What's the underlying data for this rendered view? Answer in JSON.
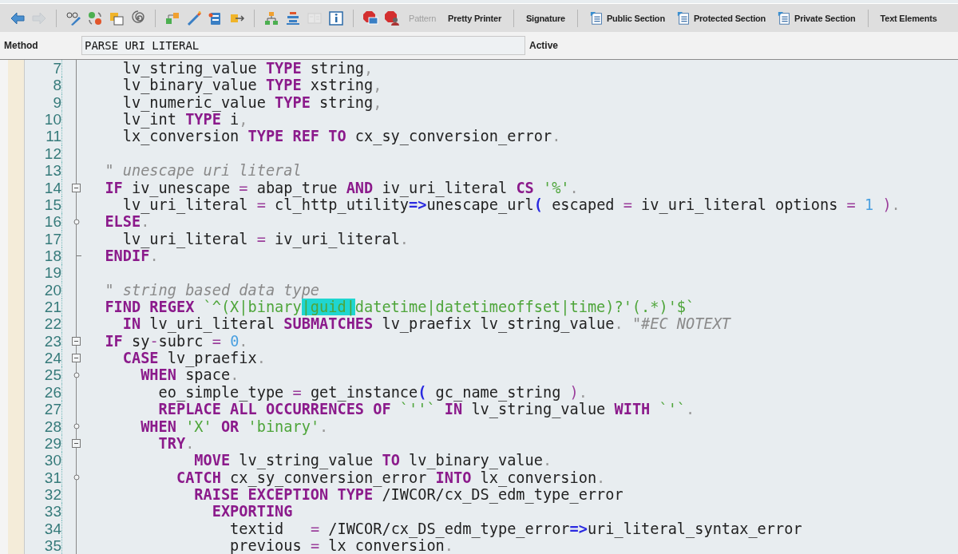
{
  "toolbar": [
    {
      "kind": "icon",
      "disabled": false
    },
    {
      "kind": "icon",
      "disabled": true
    },
    {
      "kind": "separator"
    },
    {
      "kind": "icon",
      "disabled": false
    },
    {
      "kind": "icon",
      "disabled": false
    },
    {
      "kind": "icon",
      "disabled": false
    },
    {
      "kind": "icon",
      "disabled": false
    },
    {
      "kind": "separator"
    },
    {
      "kind": "icon",
      "disabled": false
    },
    {
      "kind": "icon",
      "disabled": false
    },
    {
      "kind": "icon",
      "disabled": false
    },
    {
      "kind": "icon",
      "disabled": false
    },
    {
      "kind": "separator"
    },
    {
      "kind": "icon",
      "disabled": false
    },
    {
      "kind": "icon",
      "disabled": false
    },
    {
      "kind": "icon",
      "disabled": true
    },
    {
      "kind": "icon",
      "disabled": false
    },
    {
      "kind": "separator"
    },
    {
      "kind": "icon",
      "disabled": false
    },
    {
      "kind": "icon",
      "disabled": false
    },
    {
      "kind": "button",
      "label": "Pattern",
      "with_icon": false,
      "disabled": true
    },
    {
      "kind": "button",
      "label": "Pretty Printer",
      "with_icon": false,
      "disabled": false
    },
    {
      "kind": "separator"
    },
    {
      "kind": "button",
      "label": "Signature",
      "with_icon": false,
      "disabled": false
    },
    {
      "kind": "separator"
    },
    {
      "kind": "button",
      "label": "Public Section",
      "with_icon": true,
      "disabled": false
    },
    {
      "kind": "button",
      "label": "Protected Section",
      "with_icon": true,
      "disabled": false
    },
    {
      "kind": "button",
      "label": "Private Section",
      "with_icon": true,
      "disabled": false
    },
    {
      "kind": "separator"
    },
    {
      "kind": "button",
      "label": "Text Elements",
      "with_icon": false,
      "disabled": false
    }
  ],
  "header": {
    "label": "Method",
    "value": "PARSE_URI_LITERAL",
    "status": "Active"
  },
  "lines": [
    {
      "number": "7",
      "code": [
        {
          "kind": "plain",
          "text": "    lv_string_value "
        },
        {
          "kind": "keyword",
          "text": "TYPE"
        },
        {
          "kind": "plain",
          "text": " string"
        },
        {
          "kind": "punct",
          "text": ","
        }
      ]
    },
    {
      "number": "8",
      "code": [
        {
          "kind": "plain",
          "text": "    lv_binary_value "
        },
        {
          "kind": "keyword",
          "text": "TYPE"
        },
        {
          "kind": "plain",
          "text": " xstring"
        },
        {
          "kind": "punct",
          "text": ","
        }
      ]
    },
    {
      "number": "9",
      "code": [
        {
          "kind": "plain",
          "text": "    lv_numeric_value "
        },
        {
          "kind": "keyword",
          "text": "TYPE"
        },
        {
          "kind": "plain",
          "text": " string"
        },
        {
          "kind": "punct",
          "text": ","
        }
      ]
    },
    {
      "number": "10",
      "code": [
        {
          "kind": "plain",
          "text": "    lv_int "
        },
        {
          "kind": "keyword",
          "text": "TYPE"
        },
        {
          "kind": "plain",
          "text": " i"
        },
        {
          "kind": "punct",
          "text": ","
        }
      ]
    },
    {
      "number": "11",
      "code": [
        {
          "kind": "plain",
          "text": "    lx_conversion "
        },
        {
          "kind": "keyword",
          "text": "TYPE REF TO"
        },
        {
          "kind": "plain",
          "text": " cx_sy_conversion_error"
        },
        {
          "kind": "punct",
          "text": "."
        }
      ]
    },
    {
      "number": "12"
    },
    {
      "number": "13",
      "code": [
        {
          "kind": "comment",
          "text": "  \" unescape uri literal"
        }
      ]
    },
    {
      "number": "14",
      "fold": {
        "kind": "toggle",
        "expanded": true
      },
      "code": [
        {
          "kind": "keyword",
          "text": "  IF"
        },
        {
          "kind": "plain",
          "text": " iv_unescape "
        },
        {
          "kind": "operator",
          "text": "="
        },
        {
          "kind": "plain",
          "text": " abap_true "
        },
        {
          "kind": "keyword",
          "text": "AND"
        },
        {
          "kind": "plain",
          "text": " iv_uri_literal "
        },
        {
          "kind": "keyword",
          "text": "CS "
        },
        {
          "kind": "string",
          "text": "'%'"
        },
        {
          "kind": "punct",
          "text": "."
        }
      ]
    },
    {
      "number": "15",
      "code": [
        {
          "kind": "plain",
          "text": "    lv_uri_literal "
        },
        {
          "kind": "operator",
          "text": "="
        },
        {
          "kind": "plain",
          "text": " cl_http_utility"
        },
        {
          "kind": "arrow",
          "text": "=>"
        },
        {
          "kind": "plain",
          "text": "unescape_url"
        },
        {
          "kind": "arrow",
          "text": "("
        },
        {
          "kind": "plain",
          "text": " escaped "
        },
        {
          "kind": "operator",
          "text": "="
        },
        {
          "kind": "plain",
          "text": " iv_uri_literal options "
        },
        {
          "kind": "operator",
          "text": "= "
        },
        {
          "kind": "number",
          "text": "1"
        },
        {
          "kind": "operator",
          "text": " )"
        },
        {
          "kind": "punct",
          "text": "."
        }
      ]
    },
    {
      "number": "16",
      "fold": {
        "kind": "branch"
      },
      "code": [
        {
          "kind": "keyword",
          "text": "  ELSE"
        },
        {
          "kind": "punct",
          "text": "."
        }
      ]
    },
    {
      "number": "17",
      "code": [
        {
          "kind": "plain",
          "text": "    lv_uri_literal "
        },
        {
          "kind": "operator",
          "text": "="
        },
        {
          "kind": "plain",
          "text": " iv_uri_literal"
        },
        {
          "kind": "punct",
          "text": "."
        }
      ]
    },
    {
      "number": "18",
      "fold": {
        "kind": "end"
      },
      "code": [
        {
          "kind": "keyword",
          "text": "  ENDIF"
        },
        {
          "kind": "punct",
          "text": "."
        }
      ]
    },
    {
      "number": "19"
    },
    {
      "number": "20",
      "code": [
        {
          "kind": "comment",
          "text": "  \" string based data type"
        }
      ]
    },
    {
      "number": "21",
      "code": [
        {
          "kind": "keyword",
          "text": "  FIND REGEX "
        },
        {
          "kind": "string",
          "text": "`^(X|binary"
        },
        {
          "kind": "highlight",
          "text": "|guid|"
        },
        {
          "kind": "string",
          "text": "datetime|datetimeoffset|time)?'(.*)'$`"
        }
      ]
    },
    {
      "number": "22",
      "code": [
        {
          "kind": "keyword",
          "text": "    IN"
        },
        {
          "kind": "plain",
          "text": " lv_uri_literal "
        },
        {
          "kind": "keyword",
          "text": "SUBMATCHES"
        },
        {
          "kind": "plain",
          "text": " lv_praefix lv_string_value"
        },
        {
          "kind": "punct",
          "text": ". "
        },
        {
          "kind": "comment",
          "text": "\"#EC NOTEXT"
        }
      ]
    },
    {
      "number": "23",
      "fold": {
        "kind": "toggle",
        "expanded": true
      },
      "code": [
        {
          "kind": "keyword",
          "text": "  IF"
        },
        {
          "kind": "plain",
          "text": " sy"
        },
        {
          "kind": "operator",
          "text": "-"
        },
        {
          "kind": "plain",
          "text": "subrc "
        },
        {
          "kind": "operator",
          "text": "= "
        },
        {
          "kind": "number",
          "text": "0"
        },
        {
          "kind": "punct",
          "text": "."
        }
      ]
    },
    {
      "number": "24",
      "fold": {
        "kind": "toggle",
        "expanded": true
      },
      "code": [
        {
          "kind": "keyword",
          "text": "    CASE"
        },
        {
          "kind": "plain",
          "text": " lv_praefix"
        },
        {
          "kind": "punct",
          "text": "."
        }
      ]
    },
    {
      "number": "25",
      "fold": {
        "kind": "branch"
      },
      "code": [
        {
          "kind": "keyword",
          "text": "      WHEN"
        },
        {
          "kind": "plain",
          "text": " space"
        },
        {
          "kind": "punct",
          "text": "."
        }
      ]
    },
    {
      "number": "26",
      "code": [
        {
          "kind": "plain",
          "text": "        eo_simple_type "
        },
        {
          "kind": "operator",
          "text": "="
        },
        {
          "kind": "plain",
          "text": " get_instance"
        },
        {
          "kind": "arrow",
          "text": "("
        },
        {
          "kind": "plain",
          "text": " gc_name_string "
        },
        {
          "kind": "operator",
          "text": ")"
        },
        {
          "kind": "punct",
          "text": "."
        }
      ]
    },
    {
      "number": "27",
      "code": [
        {
          "kind": "keyword",
          "text": "        REPLACE ALL OCCURRENCES OF "
        },
        {
          "kind": "string",
          "text": "`''`"
        },
        {
          "kind": "keyword",
          "text": " IN"
        },
        {
          "kind": "plain",
          "text": " lv_string_value "
        },
        {
          "kind": "keyword",
          "text": "WITH "
        },
        {
          "kind": "string",
          "text": "`'`"
        },
        {
          "kind": "punct",
          "text": "."
        }
      ]
    },
    {
      "number": "28",
      "fold": {
        "kind": "branch"
      },
      "code": [
        {
          "kind": "keyword",
          "text": "      WHEN "
        },
        {
          "kind": "string",
          "text": "'X'"
        },
        {
          "kind": "keyword",
          "text": " OR "
        },
        {
          "kind": "string",
          "text": "'binary'"
        },
        {
          "kind": "punct",
          "text": "."
        }
      ]
    },
    {
      "number": "29",
      "fold": {
        "kind": "toggle",
        "expanded": true
      },
      "code": [
        {
          "kind": "keyword",
          "text": "        TRY"
        },
        {
          "kind": "punct",
          "text": "."
        }
      ]
    },
    {
      "number": "30",
      "code": [
        {
          "kind": "keyword",
          "text": "            MOVE"
        },
        {
          "kind": "plain",
          "text": " lv_string_value "
        },
        {
          "kind": "keyword",
          "text": "TO"
        },
        {
          "kind": "plain",
          "text": " lv_binary_value"
        },
        {
          "kind": "punct",
          "text": "."
        }
      ]
    },
    {
      "number": "31",
      "fold": {
        "kind": "branch"
      },
      "code": [
        {
          "kind": "keyword",
          "text": "          CATCH"
        },
        {
          "kind": "plain",
          "text": " cx_sy_conversion_error "
        },
        {
          "kind": "keyword",
          "text": "INTO"
        },
        {
          "kind": "plain",
          "text": " lx_conversion"
        },
        {
          "kind": "punct",
          "text": "."
        }
      ]
    },
    {
      "number": "32",
      "code": [
        {
          "kind": "keyword",
          "text": "            RAISE EXCEPTION TYPE"
        },
        {
          "kind": "plain",
          "text": " /IWCOR/cx_DS_edm_type_error"
        }
      ]
    },
    {
      "number": "33",
      "code": [
        {
          "kind": "keyword",
          "text": "              EXPORTING"
        }
      ]
    },
    {
      "number": "34",
      "code": [
        {
          "kind": "plain",
          "text": "                textid   "
        },
        {
          "kind": "operator",
          "text": "="
        },
        {
          "kind": "plain",
          "text": " /IWCOR/cx_DS_edm_type_error"
        },
        {
          "kind": "arrow",
          "text": "=>"
        },
        {
          "kind": "plain",
          "text": "uri_literal_syntax_error"
        }
      ]
    },
    {
      "number": "35",
      "code": [
        {
          "kind": "plain",
          "text": "                previous "
        },
        {
          "kind": "operator",
          "text": "="
        },
        {
          "kind": "plain",
          "text": " lx_conversion"
        },
        {
          "kind": "punct",
          "text": "."
        }
      ]
    }
  ]
}
